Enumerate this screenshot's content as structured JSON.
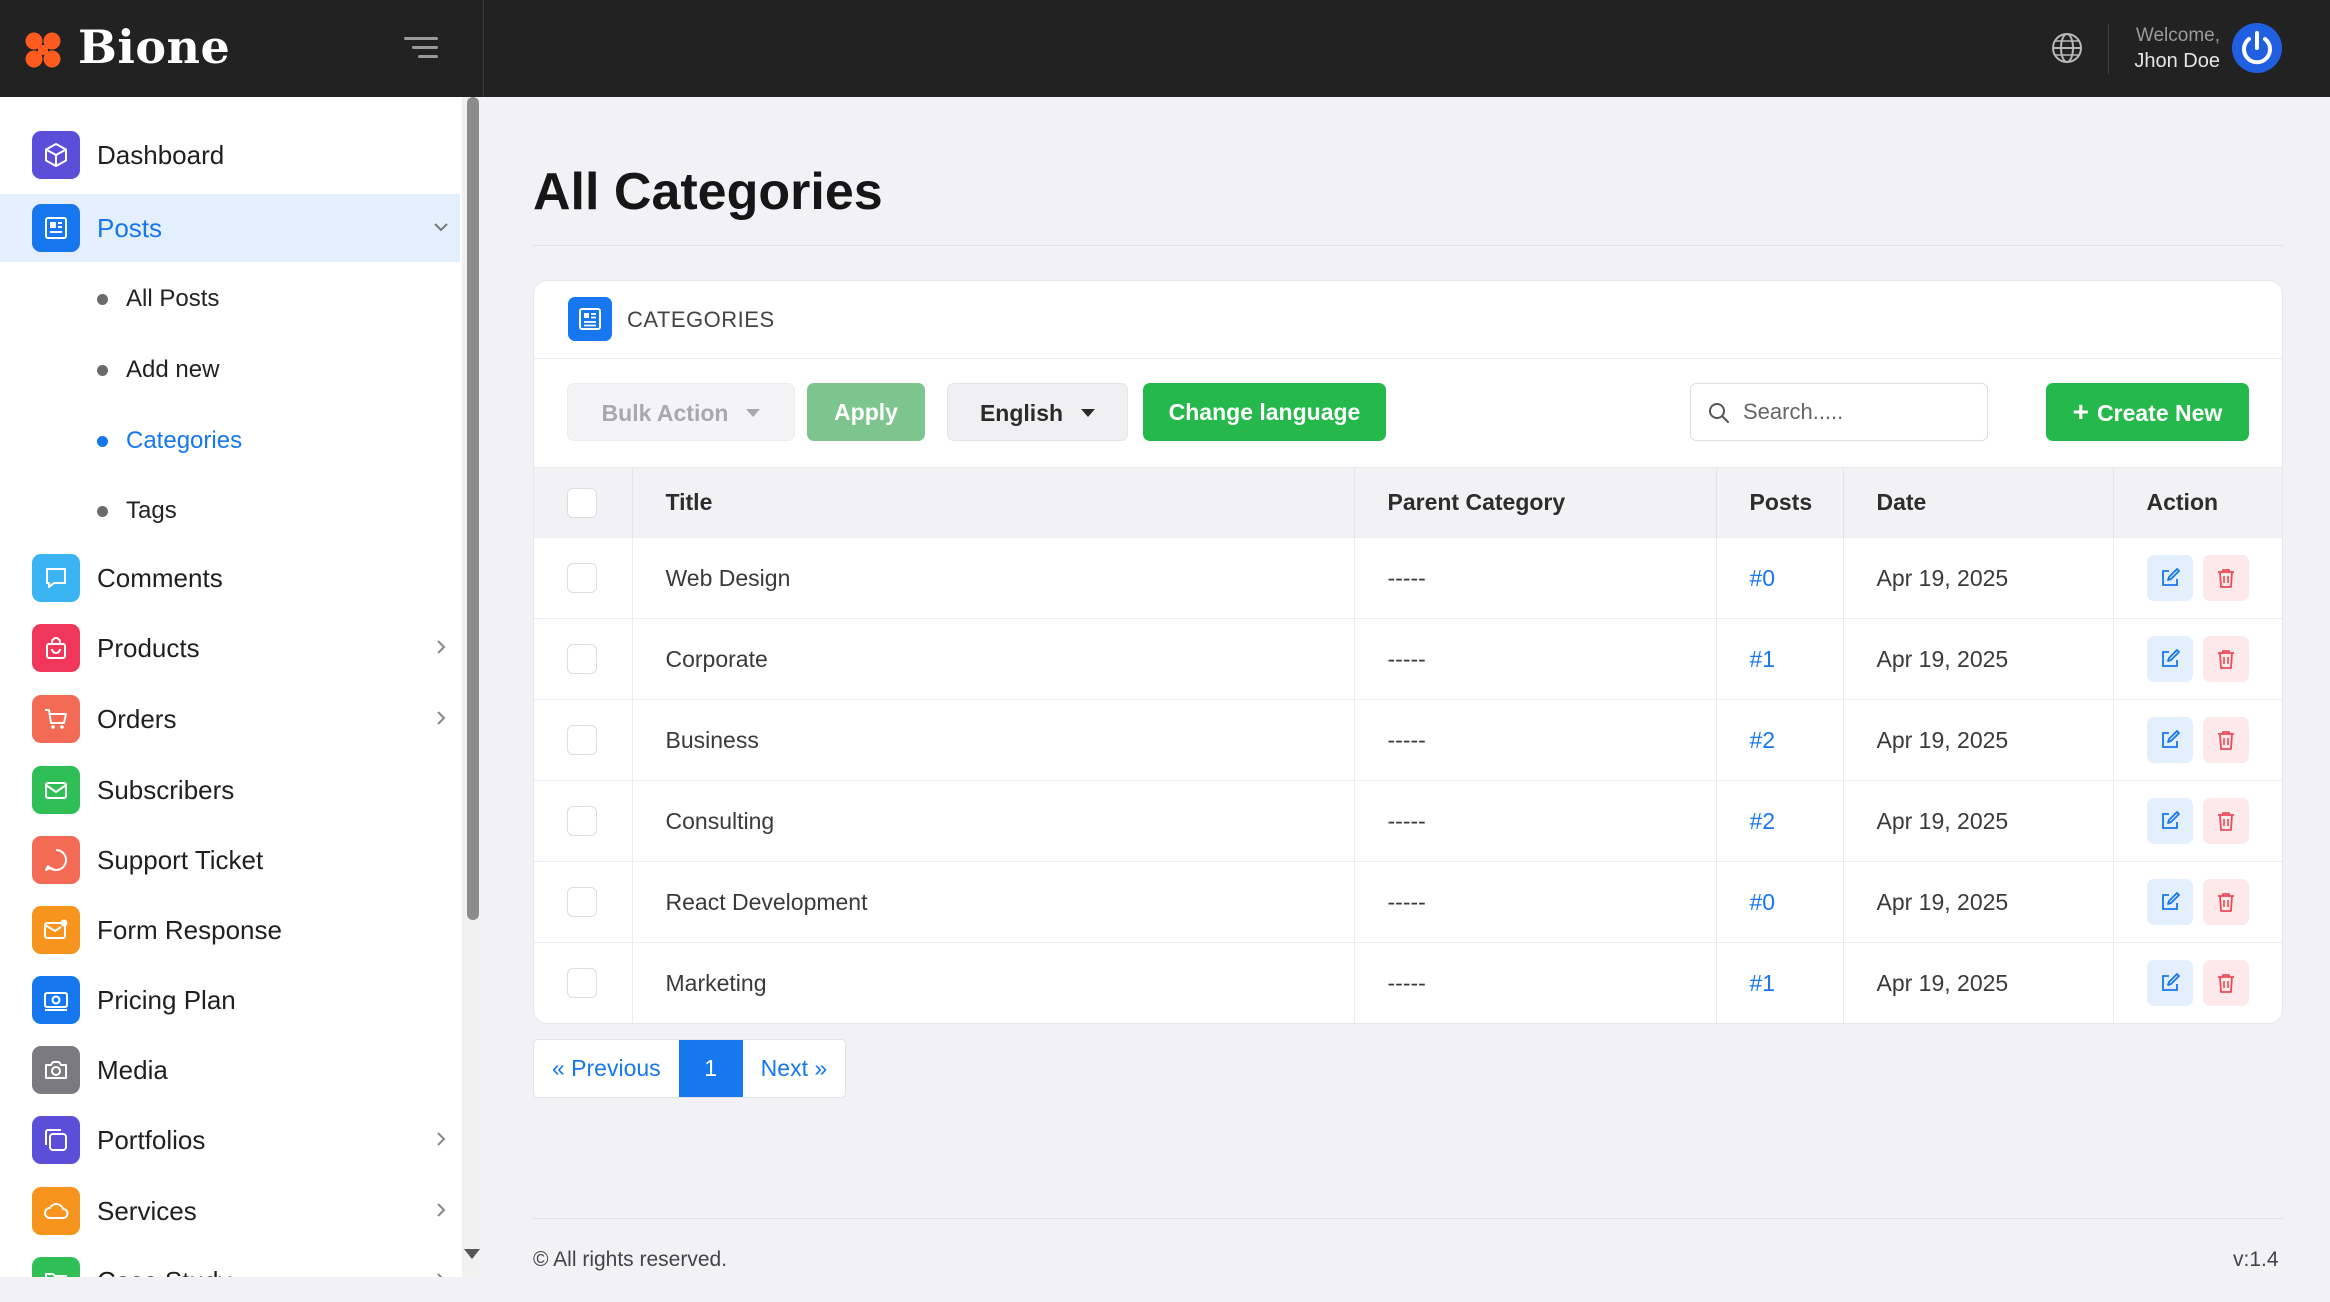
{
  "header": {
    "brand": "Bione",
    "welcome_label": "Welcome,",
    "user_name": "Jhon Doe"
  },
  "sidebar": {
    "items": [
      {
        "label": "Dashboard",
        "icon": "cube-icon",
        "color": "#5b4fd9"
      },
      {
        "label": "Posts",
        "icon": "newspaper-icon",
        "color": "#1677ee",
        "active": true,
        "expanded": true
      },
      {
        "label": "Comments",
        "icon": "chat-bubble-icon",
        "color": "#3ab4f2"
      },
      {
        "label": "Products",
        "icon": "shopping-bag-icon",
        "color": "#f0365a",
        "has_children": true
      },
      {
        "label": "Orders",
        "icon": "cart-icon",
        "color": "#f36a55",
        "has_children": true
      },
      {
        "label": "Subscribers",
        "icon": "envelope-icon",
        "color": "#2fbf56"
      },
      {
        "label": "Support Ticket",
        "icon": "support-chat-icon",
        "color": "#f36a55"
      },
      {
        "label": "Form Response",
        "icon": "mail-notification-icon",
        "color": "#f7941d"
      },
      {
        "label": "Pricing Plan",
        "icon": "money-icon",
        "color": "#1677ee"
      },
      {
        "label": "Media",
        "icon": "camera-icon",
        "color": "#7a7a80"
      },
      {
        "label": "Portfolios",
        "icon": "layers-icon",
        "color": "#5b4fd9",
        "has_children": true
      },
      {
        "label": "Services",
        "icon": "cloud-icon",
        "color": "#f7941d",
        "has_children": true
      },
      {
        "label": "Case Study",
        "icon": "folder-icon",
        "color": "#2fbf56",
        "has_children": true
      }
    ],
    "posts_sub": [
      {
        "label": "All Posts"
      },
      {
        "label": "Add new"
      },
      {
        "label": "Categories",
        "active": true
      },
      {
        "label": "Tags"
      }
    ]
  },
  "main": {
    "page_title": "All Categories",
    "card_title": "CATEGORIES",
    "bulk_action": "Bulk Action",
    "apply": "Apply",
    "language": "English",
    "change_language": "Change language",
    "search_placeholder": "Search.....",
    "create_new": "Create New",
    "columns": [
      "Title",
      "Parent Category",
      "Posts",
      "Date",
      "Action"
    ],
    "rows": [
      {
        "title": "Web Design",
        "parent": "-----",
        "posts": "#0",
        "date": "Apr 19, 2025"
      },
      {
        "title": "Corporate",
        "parent": "-----",
        "posts": "#1",
        "date": "Apr 19, 2025"
      },
      {
        "title": "Business",
        "parent": "-----",
        "posts": "#2",
        "date": "Apr 19, 2025"
      },
      {
        "title": "Consulting",
        "parent": "-----",
        "posts": "#2",
        "date": "Apr 19, 2025"
      },
      {
        "title": "React Development",
        "parent": "-----",
        "posts": "#0",
        "date": "Apr 19, 2025"
      },
      {
        "title": "Marketing",
        "parent": "-----",
        "posts": "#1",
        "date": "Apr 19, 2025"
      }
    ],
    "pagination": {
      "previous": "« Previous",
      "current": "1",
      "next": "Next »"
    }
  },
  "footer": {
    "copyright": "© All rights reserved.",
    "version": "v:1.4"
  },
  "colors": {
    "accent": "#1677ee",
    "success": "#25b84a",
    "danger": "#ea4b57",
    "topbar": "#222222"
  }
}
